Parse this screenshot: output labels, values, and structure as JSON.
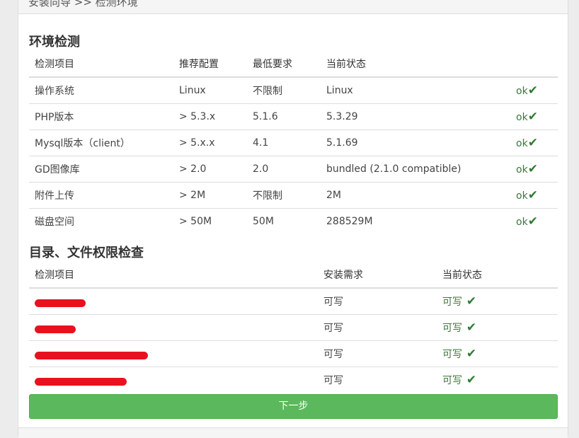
{
  "header": {
    "title": "安装向导 >> 检测环境"
  },
  "env_section": {
    "title": "环境检测",
    "columns": [
      "检测项目",
      "推荐配置",
      "最低要求",
      "当前状态"
    ],
    "rows": [
      {
        "item": "操作系统",
        "recommended": "Linux",
        "minimum": "不限制",
        "current": "Linux",
        "status": "ok"
      },
      {
        "item": "PHP版本",
        "recommended": "> 5.3.x",
        "minimum": "5.1.6",
        "current": "5.3.29",
        "status": "ok"
      },
      {
        "item": "Mysql版本（client）",
        "recommended": "> 5.x.x",
        "minimum": "4.1",
        "current": "5.1.69",
        "status": "ok"
      },
      {
        "item": "GD图像库",
        "recommended": "> 2.0",
        "minimum": "2.0",
        "current": "bundled (2.1.0 compatible)",
        "status": "ok"
      },
      {
        "item": "附件上传",
        "recommended": "> 2M",
        "minimum": "不限制",
        "current": "2M",
        "status": "ok"
      },
      {
        "item": "磁盘空间",
        "recommended": "> 50M",
        "minimum": "50M",
        "current": "288529M",
        "status": "ok"
      }
    ]
  },
  "perm_section": {
    "title": "目录、文件权限检查",
    "columns": [
      "检测项目",
      "安装需求",
      "当前状态"
    ],
    "rows": [
      {
        "requirement": "可写",
        "status": "可写"
      },
      {
        "requirement": "可写",
        "status": "可写"
      },
      {
        "requirement": "可写",
        "status": "可写"
      },
      {
        "requirement": "可写",
        "status": "可写"
      }
    ]
  },
  "next_button": {
    "label": "下一步"
  },
  "icons": {
    "check": "check-icon"
  },
  "colors": {
    "ok_text": "#3c763d",
    "button_bg": "#5cb85c",
    "redaction": "#e8111f"
  }
}
